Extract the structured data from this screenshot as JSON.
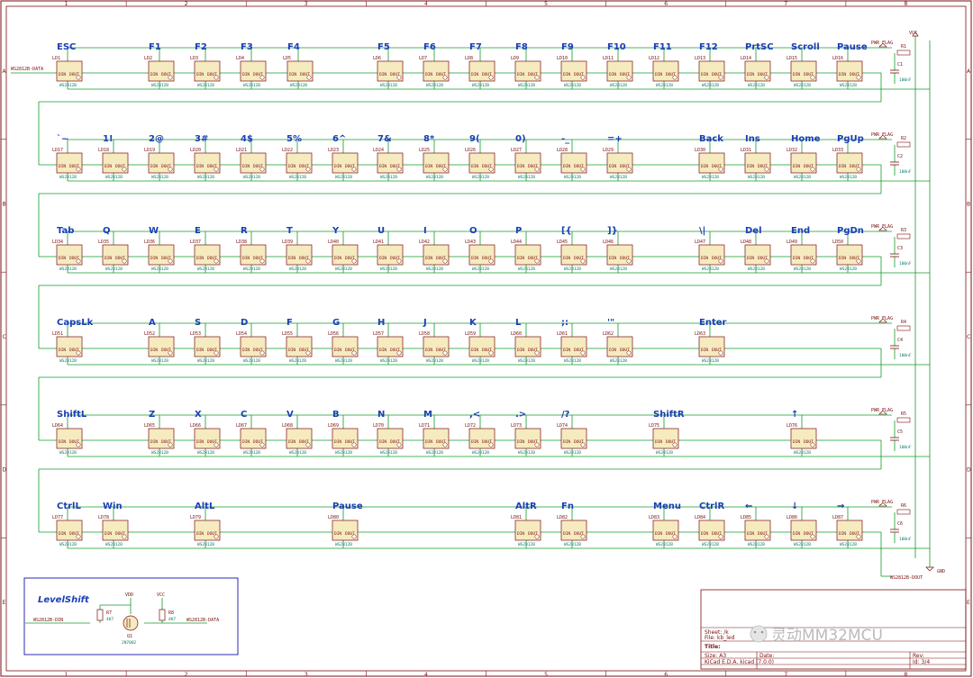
{
  "rows": [
    {
      "keys": [
        {
          "label": "ESC",
          "ref": "LD1"
        },
        {
          "label": "F1",
          "ref": "LD2"
        },
        {
          "label": "F2",
          "ref": "LD3"
        },
        {
          "label": "F3",
          "ref": "LD4"
        },
        {
          "label": "F4",
          "ref": "LD5"
        },
        {
          "label": "F5",
          "ref": "LD6"
        },
        {
          "label": "F6",
          "ref": "LD7"
        },
        {
          "label": "F7",
          "ref": "LD8"
        },
        {
          "label": "F8",
          "ref": "LD9"
        },
        {
          "label": "F9",
          "ref": "LD10"
        },
        {
          "label": "F10",
          "ref": "LD11"
        },
        {
          "label": "F11",
          "ref": "LD12"
        },
        {
          "label": "F12",
          "ref": "LD13"
        },
        {
          "label": "PrtSC",
          "ref": "LD14"
        },
        {
          "label": "Scroll",
          "ref": "LD15"
        },
        {
          "label": "Pause",
          "ref": "LD16"
        }
      ]
    },
    {
      "keys": [
        {
          "label": "`~",
          "ref": "LD17"
        },
        {
          "label": "1!",
          "ref": "LD18"
        },
        {
          "label": "2@",
          "ref": "LD19"
        },
        {
          "label": "3#",
          "ref": "LD20"
        },
        {
          "label": "4$",
          "ref": "LD21"
        },
        {
          "label": "5%",
          "ref": "LD22"
        },
        {
          "label": "6^",
          "ref": "LD23"
        },
        {
          "label": "7&",
          "ref": "LD24"
        },
        {
          "label": "8*",
          "ref": "LD25"
        },
        {
          "label": "9(",
          "ref": "LD26"
        },
        {
          "label": "0)",
          "ref": "LD27"
        },
        {
          "label": "-_",
          "ref": "LD28"
        },
        {
          "label": "=+",
          "ref": "LD29"
        },
        {
          "label": "Back",
          "ref": "LD30"
        },
        {
          "label": "Ins",
          "ref": "LD31"
        },
        {
          "label": "Home",
          "ref": "LD32"
        },
        {
          "label": "PgUp",
          "ref": "LD33"
        }
      ]
    },
    {
      "keys": [
        {
          "label": "Tab",
          "ref": "LD34"
        },
        {
          "label": "Q",
          "ref": "LD35"
        },
        {
          "label": "W",
          "ref": "LD36"
        },
        {
          "label": "E",
          "ref": "LD37"
        },
        {
          "label": "R",
          "ref": "LD38"
        },
        {
          "label": "T",
          "ref": "LD39"
        },
        {
          "label": "Y",
          "ref": "LD40"
        },
        {
          "label": "U",
          "ref": "LD41"
        },
        {
          "label": "I",
          "ref": "LD42"
        },
        {
          "label": "O",
          "ref": "LD43"
        },
        {
          "label": "P",
          "ref": "LD44"
        },
        {
          "label": "[{",
          "ref": "LD45"
        },
        {
          "label": "]}",
          "ref": "LD46"
        },
        {
          "label": "\\|",
          "ref": "LD47"
        },
        {
          "label": "Del",
          "ref": "LD48"
        },
        {
          "label": "End",
          "ref": "LD49"
        },
        {
          "label": "PgDn",
          "ref": "LD50"
        }
      ]
    },
    {
      "keys": [
        {
          "label": "CapsLk",
          "ref": "LD51"
        },
        {
          "label": "A",
          "ref": "LD52"
        },
        {
          "label": "S",
          "ref": "LD53"
        },
        {
          "label": "D",
          "ref": "LD54"
        },
        {
          "label": "F",
          "ref": "LD55"
        },
        {
          "label": "G",
          "ref": "LD56"
        },
        {
          "label": "H",
          "ref": "LD57"
        },
        {
          "label": "J",
          "ref": "LD58"
        },
        {
          "label": "K",
          "ref": "LD59"
        },
        {
          "label": "L",
          "ref": "LD60"
        },
        {
          "label": ";:",
          "ref": "LD61"
        },
        {
          "label": "'\"",
          "ref": "LD62"
        },
        {
          "label": "Enter",
          "ref": "LD63"
        }
      ]
    },
    {
      "keys": [
        {
          "label": "ShiftL",
          "ref": "LD64"
        },
        {
          "label": "Z",
          "ref": "LD65"
        },
        {
          "label": "X",
          "ref": "LD66"
        },
        {
          "label": "C",
          "ref": "LD67"
        },
        {
          "label": "V",
          "ref": "LD68"
        },
        {
          "label": "B",
          "ref": "LD69"
        },
        {
          "label": "N",
          "ref": "LD70"
        },
        {
          "label": "M",
          "ref": "LD71"
        },
        {
          "label": ",<",
          "ref": "LD72"
        },
        {
          "label": ".>",
          "ref": "LD73"
        },
        {
          "label": "/?",
          "ref": "LD74"
        },
        {
          "label": "ShiftR",
          "ref": "LD75"
        },
        {
          "label": "↑",
          "ref": "LD76"
        }
      ]
    },
    {
      "keys": [
        {
          "label": "CtrlL",
          "ref": "LD77"
        },
        {
          "label": "Win",
          "ref": "LD78"
        },
        {
          "label": "AltL",
          "ref": "LD79"
        },
        {
          "label": "Pause",
          "ref": "LD80"
        },
        {
          "label": "AltR",
          "ref": "LD81"
        },
        {
          "label": "Fn",
          "ref": "LD82"
        },
        {
          "label": "Menu",
          "ref": "LD83"
        },
        {
          "label": "CtrlR",
          "ref": "LD84"
        },
        {
          "label": "←",
          "ref": "LD85"
        },
        {
          "label": "↓",
          "ref": "LD86"
        },
        {
          "label": "→",
          "ref": "LD87"
        }
      ]
    }
  ],
  "part_value": "WS2812B",
  "pin_labels": {
    "din": "DIN",
    "dout": "DOUT",
    "vdd": "VDD",
    "vss": "VSS"
  },
  "power_rows": [
    {
      "flag": "PWR_FLAG",
      "resistor": "R1",
      "cap": "C1",
      "cap_value": "100nF"
    },
    {
      "flag": "PWR_FLAG",
      "resistor": "R2",
      "cap": "C2",
      "cap_value": "100nF"
    },
    {
      "flag": "PWR_FLAG",
      "resistor": "R3",
      "cap": "C3",
      "cap_value": "100nF"
    },
    {
      "flag": "PWR_FLAG",
      "resistor": "R4",
      "cap": "C4",
      "cap_value": "100nF"
    },
    {
      "flag": "PWR_FLAG",
      "resistor": "R5",
      "cap": "C5",
      "cap_value": "100nF"
    },
    {
      "flag": "PWR_FLAG",
      "resistor": "R6",
      "cap": "C6",
      "cap_value": "100nF"
    }
  ],
  "nets": {
    "data_in": "WS2812B-DATA",
    "data_out": "WS2812B-DOUT",
    "vcc": "VCC",
    "gnd": "GND"
  },
  "level_shift": {
    "title": "LevelShift",
    "input_net": "WS2812B-DIN",
    "output_net": "WS2812B-DATA",
    "vdd": "VDD",
    "vcc": "VCC",
    "r7": "R7",
    "r7_value": "4K7",
    "r8": "R8",
    "r8_value": "4K7",
    "q1": "Q1",
    "q1_value": "2N7002"
  },
  "title_block": {
    "sheet": "Sheet: /k",
    "file": "File: kb_led",
    "title_label": "Title:",
    "size": "Size: A3",
    "date_label": "Date:",
    "rev_label": "Rev:",
    "tool": "KiCad E.D.A.  kicad (7.0.0)",
    "id": "Id: 3/4"
  },
  "border": {
    "cols": [
      "1",
      "2",
      "3",
      "4",
      "5",
      "6",
      "7",
      "8"
    ],
    "rows": [
      "A",
      "B",
      "C",
      "D",
      "E"
    ]
  },
  "watermark": "灵动MM32MCU",
  "colors": {
    "wire": "#129b2a",
    "border": "#7a0f0f",
    "label": "#1a3fb5",
    "body": "#f6eabf",
    "bodystroke": "#7a0f0f",
    "box": "#2a2ab5"
  }
}
